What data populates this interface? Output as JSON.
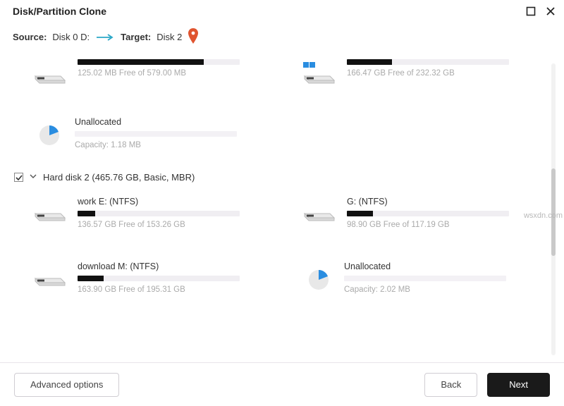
{
  "window": {
    "title": "Disk/Partition Clone"
  },
  "path": {
    "source_label": "Source:",
    "source_value": "Disk 0 D:",
    "target_label": "Target:",
    "target_value": "Disk 2"
  },
  "partitions_top": [
    {
      "name": "",
      "free": "125.02 MB Free of 579.00 MB",
      "fillPct": 78,
      "hasBlueTab": false
    },
    {
      "name": "",
      "free": "166.47 GB Free of 232.32 GB",
      "fillPct": 28,
      "hasBlueTab": true
    }
  ],
  "unallocated1": {
    "name": "Unallocated",
    "capacity": "Capacity: 1.18 MB"
  },
  "disk2_header": "Hard disk 2 (465.76 GB, Basic, MBR)",
  "disk2_checked": true,
  "disk2_partitions_row1": [
    {
      "name": "work E: (NTFS)",
      "free": "136.57 GB Free of 153.26 GB",
      "fillPct": 11
    },
    {
      "name": "G: (NTFS)",
      "free": "98.90 GB Free of 117.19 GB",
      "fillPct": 16
    }
  ],
  "disk2_partitions_row2": [
    {
      "name": "download M: (NTFS)",
      "free": "163.90 GB Free of 195.31 GB",
      "fillPct": 16
    }
  ],
  "unallocated2": {
    "name": "Unallocated",
    "capacity": "Capacity: 2.02 MB"
  },
  "footer": {
    "advanced": "Advanced options",
    "back": "Back",
    "next": "Next"
  },
  "watermark": "wsxdn.com"
}
